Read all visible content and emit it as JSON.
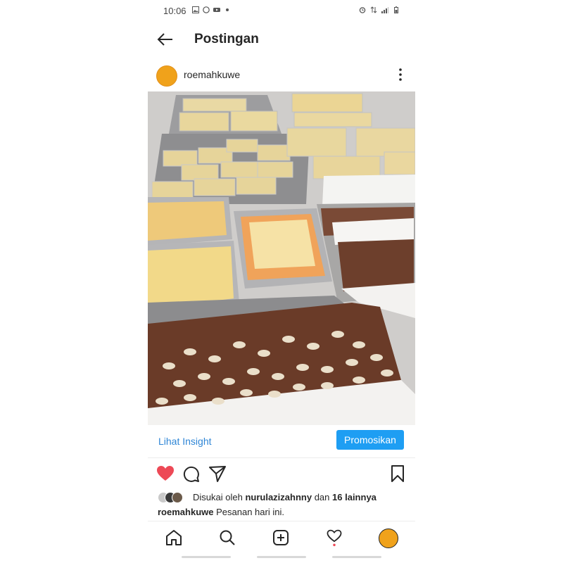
{
  "status_bar": {
    "time": "10:06"
  },
  "header": {
    "title": "Postingan"
  },
  "post": {
    "username": "roemahkuwe",
    "insight_label": "Lihat Insight",
    "promote_label": "Promosikan",
    "liked_prefix": "Disukai oleh",
    "liked_user": "nurulazizahnny",
    "liked_joiner": "dan",
    "liked_others": "16 lainnya",
    "caption_user": "roemahkuwe",
    "caption_text": "Pesanan hari ini."
  },
  "colors": {
    "accent_blue": "#1e9ef3",
    "link_blue": "#2f86d6",
    "like_red": "#ed4956",
    "avatar_orange": "#f0a21b"
  },
  "icons": [
    "back-arrow-icon",
    "more-vertical-icon",
    "heart-icon",
    "comment-icon",
    "share-icon",
    "bookmark-icon",
    "home-icon",
    "search-icon",
    "add-post-icon",
    "activity-icon",
    "profile-avatar-icon"
  ]
}
